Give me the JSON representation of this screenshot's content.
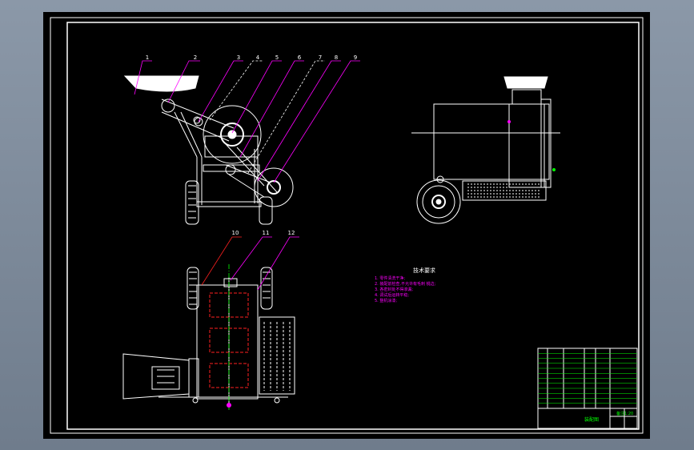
{
  "balloons": [
    "1",
    "2",
    "3",
    "4",
    "5",
    "6",
    "7",
    "8",
    "9",
    "10",
    "11",
    "12"
  ],
  "tech": {
    "title": "技术要求",
    "lines": [
      "1. 零件清洗干净;",
      "2. 装配前检查,不允许有毛刺 锐边;",
      "3. 各密封处不得渗漏;",
      "4. 调试后运转平稳;",
      "5. 整机涂漆;"
    ]
  },
  "title_block": {
    "drawing_name": "装配图",
    "scale": "1:20",
    "unit": "备注"
  },
  "colors": {
    "line": "#ffffff",
    "accent": "#ff00ff",
    "red": "#ff2020",
    "green": "#00ff00",
    "bg": "#000000"
  }
}
